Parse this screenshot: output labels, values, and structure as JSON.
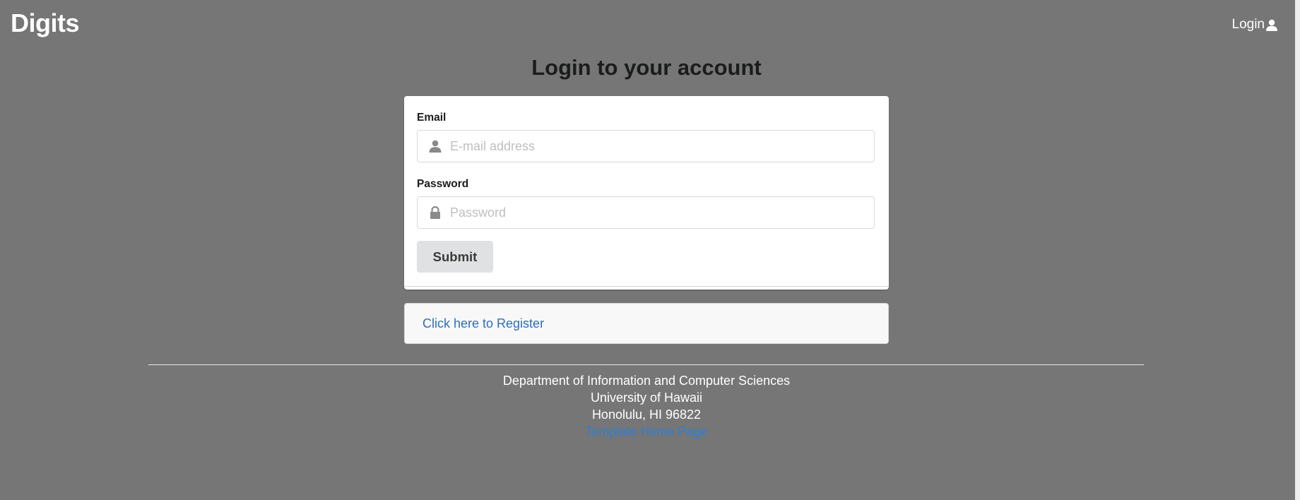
{
  "navbar": {
    "brand": "Digits",
    "login_label": "Login",
    "login_icon": "user-icon"
  },
  "page": {
    "title": "Login to your account"
  },
  "form": {
    "email_label": "Email",
    "email_placeholder": "E-mail address",
    "email_value": "",
    "email_icon": "user-icon",
    "password_label": "Password",
    "password_placeholder": "Password",
    "password_value": "",
    "password_icon": "lock-icon",
    "submit_label": "Submit"
  },
  "register": {
    "link_text": "Click here to Register"
  },
  "footer": {
    "line1": "Department of Information and Computer Sciences",
    "line2": "University of Hawaii",
    "line3": "Honolulu, HI 96822",
    "link_text": "Template Home Page"
  },
  "colors": {
    "background": "#767676",
    "link": "#2d6fb8",
    "button": "#e0e1e2"
  }
}
